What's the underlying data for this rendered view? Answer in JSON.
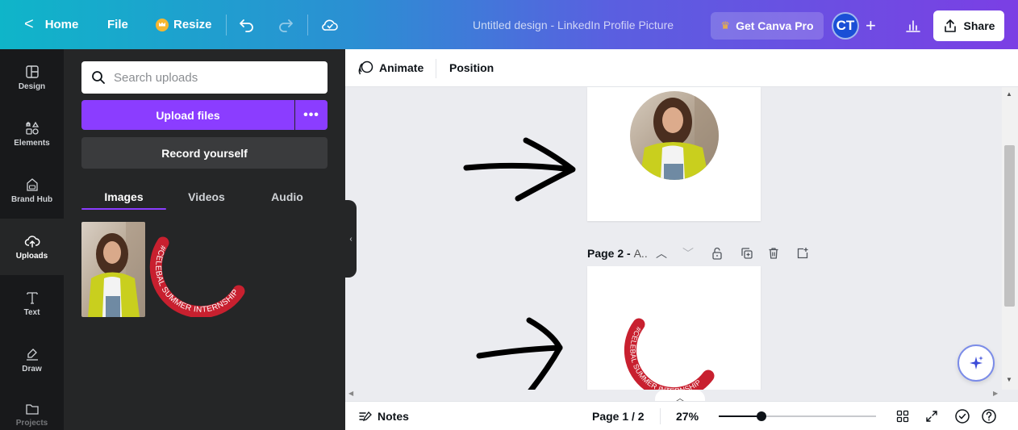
{
  "topbar": {
    "home_label": "Home",
    "file_label": "File",
    "resize_label": "Resize",
    "design_title": "Untitled design - LinkedIn Profile Picture",
    "pro_label": "Get Canva Pro",
    "avatar_initials": "CT",
    "share_label": "Share",
    "colors": {
      "gradient_start": "#0fb5c9",
      "gradient_end": "#7b3fe4"
    }
  },
  "rail": {
    "items": [
      {
        "label": "Design",
        "icon": "layout-icon"
      },
      {
        "label": "Elements",
        "icon": "shapes-icon"
      },
      {
        "label": "Brand Hub",
        "icon": "brand-hub-icon"
      },
      {
        "label": "Uploads",
        "icon": "cloud-upload-icon",
        "active": true
      },
      {
        "label": "Text",
        "icon": "text-icon"
      },
      {
        "label": "Draw",
        "icon": "pen-icon"
      },
      {
        "label": "Projects",
        "icon": "folder-icon"
      }
    ]
  },
  "panel": {
    "search_placeholder": "Search uploads",
    "upload_label": "Upload files",
    "more_label": "•••",
    "record_label": "Record yourself",
    "tabs": [
      {
        "label": "Images",
        "active": true
      },
      {
        "label": "Videos"
      },
      {
        "label": "Audio"
      }
    ],
    "accent": "#8b3dff",
    "sticker_text": "#CELEBAL SUMMER INTERNSHIP"
  },
  "context_toolbar": {
    "animate_label": "Animate",
    "position_label": "Position"
  },
  "canvas": {
    "page2_label": "Page 2 -",
    "page2_title": "A..",
    "sticker_text": "#CELEBAL SUMMER INTERNSHIP"
  },
  "bottombar": {
    "notes_label": "Notes",
    "page_indicator": "Page 1 / 2",
    "zoom_label": "27%",
    "zoom_fraction": 0.27
  }
}
